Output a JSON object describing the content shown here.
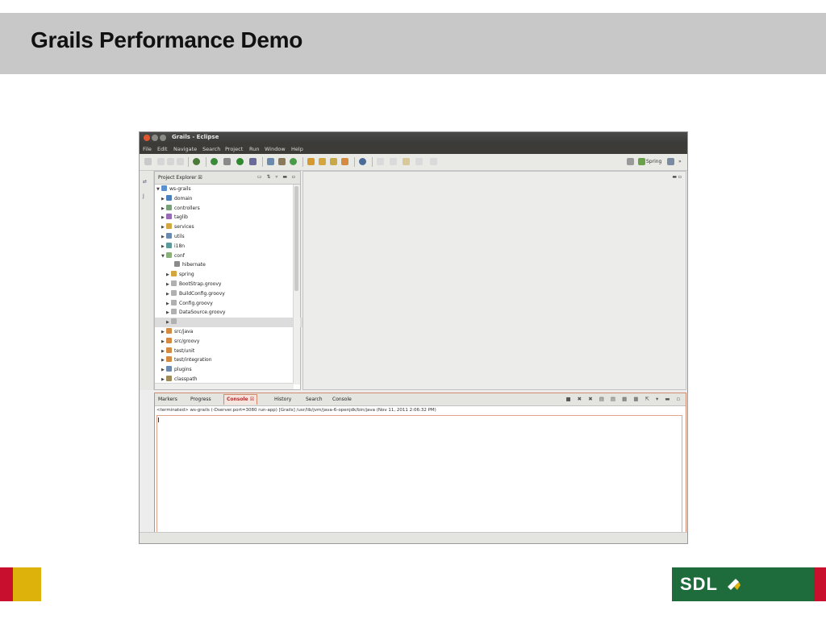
{
  "slide": {
    "title": "Grails Performance Demo"
  },
  "window": {
    "title": "Grails - Eclipse"
  },
  "menu": [
    "File",
    "Edit",
    "Navigate",
    "Search",
    "Project",
    "Run",
    "Window",
    "Help"
  ],
  "toolbar": {
    "perspective_label": "Spring"
  },
  "explorer": {
    "tab_label": "Project Explorer ☒",
    "items": [
      {
        "label": "ws-grails",
        "arrow": "▼",
        "icon_color": "#5b8fd0",
        "icon": "project-icon"
      },
      {
        "label": "domain",
        "arrow": "▶",
        "icon_color": "#4a7fc0",
        "icon": "domain-icon"
      },
      {
        "label": "controllers",
        "arrow": "▶",
        "icon_color": "#7aa07a",
        "icon": "controllers-icon"
      },
      {
        "label": "taglib",
        "arrow": "▶",
        "icon_color": "#9a6ab8",
        "icon": "taglib-icon"
      },
      {
        "label": "services",
        "arrow": "▶",
        "icon_color": "#d4a640",
        "icon": "services-icon"
      },
      {
        "label": "utils",
        "arrow": "▶",
        "icon_color": "#6a8ab0",
        "icon": "utils-icon"
      },
      {
        "label": "i18n",
        "arrow": "▶",
        "icon_color": "#5a9a9a",
        "icon": "i18n-icon"
      },
      {
        "label": "conf",
        "arrow": "▼",
        "icon_color": "#8ab07a",
        "icon": "conf-icon"
      },
      {
        "label": "hibernate",
        "arrow": "",
        "icon_color": "#8a8a8a",
        "icon": "folder-icon"
      },
      {
        "label": "spring",
        "arrow": "▶",
        "icon_color": "#d4a640",
        "icon": "package-icon"
      },
      {
        "label": "BootStrap.groovy",
        "arrow": "▶",
        "icon_color": "#b0b0b0",
        "icon": "groovy-file-icon"
      },
      {
        "label": "BuildConfig.groovy",
        "arrow": "▶",
        "icon_color": "#b0b0b0",
        "icon": "groovy-file-icon"
      },
      {
        "label": "Config.groovy",
        "arrow": "▶",
        "icon_color": "#b0b0b0",
        "icon": "groovy-file-icon"
      },
      {
        "label": "DataSource.groovy",
        "arrow": "▶",
        "icon_color": "#b0b0b0",
        "icon": "groovy-file-icon"
      },
      {
        "label": "",
        "arrow": "▶",
        "icon_color": "#b0b0b0",
        "icon": "groovy-file-icon"
      },
      {
        "label": "src/java",
        "arrow": "▶",
        "icon_color": "#d48a40",
        "icon": "source-folder-icon"
      },
      {
        "label": "src/groovy",
        "arrow": "▶",
        "icon_color": "#d48a40",
        "icon": "source-folder-icon"
      },
      {
        "label": "test/unit",
        "arrow": "▶",
        "icon_color": "#d48a40",
        "icon": "source-folder-icon"
      },
      {
        "label": "test/integration",
        "arrow": "▶",
        "icon_color": "#d48a40",
        "icon": "source-folder-icon"
      },
      {
        "label": "plugins",
        "arrow": "▶",
        "icon_color": "#6a8ab0",
        "icon": "plugins-icon"
      },
      {
        "label": "classpath",
        "arrow": "▶",
        "icon_color": "#a08a5a",
        "icon": "library-icon"
      }
    ]
  },
  "bottom_panel": {
    "tabs": [
      {
        "label": "Markers",
        "active": false
      },
      {
        "label": "Progress",
        "active": false
      },
      {
        "label": "Console ☒",
        "active": true
      },
      {
        "label": "History",
        "active": false
      },
      {
        "label": "Search",
        "active": false
      },
      {
        "label": "Console",
        "active": false
      }
    ],
    "status": "<terminated> ws-grails (-Dserver.port=3080 run-app) [Grails] /usr/lib/jvm/java-6-openjdk/bin/java (Nov 11, 2011 2:06:32 PM)"
  },
  "logo": {
    "text": "SDL"
  },
  "colors": {
    "header_band": "#c8c8c8",
    "accent_red": "#c8102e",
    "accent_yellow": "#ddb20a",
    "logo_green": "#1e6b3c",
    "active_tab": "#d38a6b"
  }
}
